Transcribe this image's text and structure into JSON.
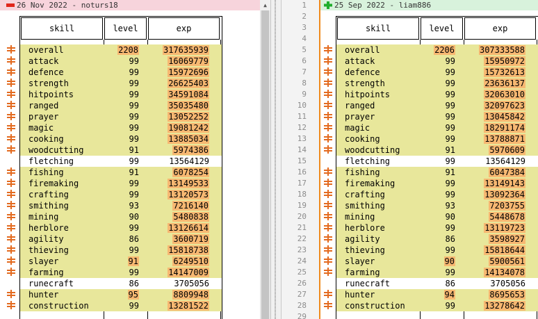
{
  "left": {
    "header": "26 Nov 2022 - noturs18",
    "columns": {
      "skill": "skill",
      "level": "level",
      "exp": "exp"
    },
    "rows": [
      {
        "skill": "overall",
        "level": "2208",
        "exp": "317635939",
        "changed": true,
        "level_hl": true,
        "exp_hl": true
      },
      {
        "skill": "attack",
        "level": "99",
        "exp": "16069779",
        "changed": true,
        "level_hl": false,
        "exp_hl": true
      },
      {
        "skill": "defence",
        "level": "99",
        "exp": "15972696",
        "changed": true,
        "level_hl": false,
        "exp_hl": true
      },
      {
        "skill": "strength",
        "level": "99",
        "exp": "26625403",
        "changed": true,
        "level_hl": false,
        "exp_hl": true
      },
      {
        "skill": "hitpoints",
        "level": "99",
        "exp": "34591084",
        "changed": true,
        "level_hl": false,
        "exp_hl": true
      },
      {
        "skill": "ranged",
        "level": "99",
        "exp": "35035480",
        "changed": true,
        "level_hl": false,
        "exp_hl": true
      },
      {
        "skill": "prayer",
        "level": "99",
        "exp": "13052252",
        "changed": true,
        "level_hl": false,
        "exp_hl": true
      },
      {
        "skill": "magic",
        "level": "99",
        "exp": "19081242",
        "changed": true,
        "level_hl": false,
        "exp_hl": true
      },
      {
        "skill": "cooking",
        "level": "99",
        "exp": "13885034",
        "changed": true,
        "level_hl": false,
        "exp_hl": true
      },
      {
        "skill": "woodcutting",
        "level": "91",
        "exp": "5974386",
        "changed": true,
        "level_hl": false,
        "exp_hl": true
      },
      {
        "skill": "fletching",
        "level": "99",
        "exp": "13564129",
        "changed": false,
        "level_hl": false,
        "exp_hl": false
      },
      {
        "skill": "fishing",
        "level": "91",
        "exp": "6078254",
        "changed": true,
        "level_hl": false,
        "exp_hl": true
      },
      {
        "skill": "firemaking",
        "level": "99",
        "exp": "13149533",
        "changed": true,
        "level_hl": false,
        "exp_hl": true
      },
      {
        "skill": "crafting",
        "level": "99",
        "exp": "13120573",
        "changed": true,
        "level_hl": false,
        "exp_hl": true
      },
      {
        "skill": "smithing",
        "level": "93",
        "exp": "7216140",
        "changed": true,
        "level_hl": false,
        "exp_hl": true
      },
      {
        "skill": "mining",
        "level": "90",
        "exp": "5480838",
        "changed": true,
        "level_hl": false,
        "exp_hl": true
      },
      {
        "skill": "herblore",
        "level": "99",
        "exp": "13126614",
        "changed": true,
        "level_hl": false,
        "exp_hl": true
      },
      {
        "skill": "agility",
        "level": "86",
        "exp": "3600719",
        "changed": true,
        "level_hl": false,
        "exp_hl": true
      },
      {
        "skill": "thieving",
        "level": "99",
        "exp": "15818738",
        "changed": true,
        "level_hl": false,
        "exp_hl": true
      },
      {
        "skill": "slayer",
        "level": "91",
        "exp": "6249510",
        "changed": true,
        "level_hl": true,
        "exp_hl": true
      },
      {
        "skill": "farming",
        "level": "99",
        "exp": "14147009",
        "changed": true,
        "level_hl": false,
        "exp_hl": true
      },
      {
        "skill": "runecraft",
        "level": "86",
        "exp": "3705056",
        "changed": false,
        "level_hl": false,
        "exp_hl": false
      },
      {
        "skill": "hunter",
        "level": "95",
        "exp": "8809948",
        "changed": true,
        "level_hl": true,
        "exp_hl": true
      },
      {
        "skill": "construction",
        "level": "99",
        "exp": "13281522",
        "changed": true,
        "level_hl": false,
        "exp_hl": true
      }
    ]
  },
  "right": {
    "header": "25 Sep 2022 - liam886",
    "columns": {
      "skill": "skill",
      "level": "level",
      "exp": "exp"
    },
    "rows": [
      {
        "skill": "overall",
        "level": "2206",
        "exp": "307333588",
        "changed": true,
        "level_hl": true,
        "exp_hl": true
      },
      {
        "skill": "attack",
        "level": "99",
        "exp": "15950972",
        "changed": true,
        "level_hl": false,
        "exp_hl": true
      },
      {
        "skill": "defence",
        "level": "99",
        "exp": "15732613",
        "changed": true,
        "level_hl": false,
        "exp_hl": true
      },
      {
        "skill": "strength",
        "level": "99",
        "exp": "23636137",
        "changed": true,
        "level_hl": false,
        "exp_hl": true
      },
      {
        "skill": "hitpoints",
        "level": "99",
        "exp": "32063010",
        "changed": true,
        "level_hl": false,
        "exp_hl": true
      },
      {
        "skill": "ranged",
        "level": "99",
        "exp": "32097623",
        "changed": true,
        "level_hl": false,
        "exp_hl": true
      },
      {
        "skill": "prayer",
        "level": "99",
        "exp": "13045842",
        "changed": true,
        "level_hl": false,
        "exp_hl": true
      },
      {
        "skill": "magic",
        "level": "99",
        "exp": "18291174",
        "changed": true,
        "level_hl": false,
        "exp_hl": true
      },
      {
        "skill": "cooking",
        "level": "99",
        "exp": "13788871",
        "changed": true,
        "level_hl": false,
        "exp_hl": true
      },
      {
        "skill": "woodcutting",
        "level": "91",
        "exp": "5970609",
        "changed": true,
        "level_hl": false,
        "exp_hl": true
      },
      {
        "skill": "fletching",
        "level": "99",
        "exp": "13564129",
        "changed": false,
        "level_hl": false,
        "exp_hl": false
      },
      {
        "skill": "fishing",
        "level": "91",
        "exp": "6047384",
        "changed": true,
        "level_hl": false,
        "exp_hl": true
      },
      {
        "skill": "firemaking",
        "level": "99",
        "exp": "13149143",
        "changed": true,
        "level_hl": false,
        "exp_hl": true
      },
      {
        "skill": "crafting",
        "level": "99",
        "exp": "13092364",
        "changed": true,
        "level_hl": false,
        "exp_hl": true
      },
      {
        "skill": "smithing",
        "level": "93",
        "exp": "7203755",
        "changed": true,
        "level_hl": false,
        "exp_hl": true
      },
      {
        "skill": "mining",
        "level": "90",
        "exp": "5448678",
        "changed": true,
        "level_hl": false,
        "exp_hl": true
      },
      {
        "skill": "herblore",
        "level": "99",
        "exp": "13119723",
        "changed": true,
        "level_hl": false,
        "exp_hl": true
      },
      {
        "skill": "agility",
        "level": "86",
        "exp": "3598927",
        "changed": true,
        "level_hl": false,
        "exp_hl": true
      },
      {
        "skill": "thieving",
        "level": "99",
        "exp": "15818644",
        "changed": true,
        "level_hl": false,
        "exp_hl": true
      },
      {
        "skill": "slayer",
        "level": "90",
        "exp": "5900561",
        "changed": true,
        "level_hl": true,
        "exp_hl": true
      },
      {
        "skill": "farming",
        "level": "99",
        "exp": "14134078",
        "changed": true,
        "level_hl": false,
        "exp_hl": true
      },
      {
        "skill": "runecraft",
        "level": "86",
        "exp": "3705056",
        "changed": false,
        "level_hl": false,
        "exp_hl": false
      },
      {
        "skill": "hunter",
        "level": "94",
        "exp": "8695653",
        "changed": true,
        "level_hl": true,
        "exp_hl": true
      },
      {
        "skill": "construction",
        "level": "99",
        "exp": "13278642",
        "changed": true,
        "level_hl": false,
        "exp_hl": true
      }
    ]
  },
  "line_numbers": [
    "1",
    "2",
    "3",
    "4",
    "5",
    "6",
    "7",
    "8",
    "9",
    "10",
    "11",
    "12",
    "13",
    "14",
    "15",
    "16",
    "17",
    "18",
    "19",
    "20",
    "21",
    "22",
    "23",
    "24",
    "25",
    "26",
    "27",
    "28",
    "29"
  ],
  "colors": {
    "changed_row": "#e8e79b",
    "changed_value": "#f7b872",
    "left_header": "#f7d4dc",
    "right_header": "#d8f2dc",
    "pane_border": "#f08a1c"
  },
  "icons": {
    "left_header": "minus-icon",
    "right_header": "plus-icon",
    "row_marker": "change-marker-icon"
  }
}
